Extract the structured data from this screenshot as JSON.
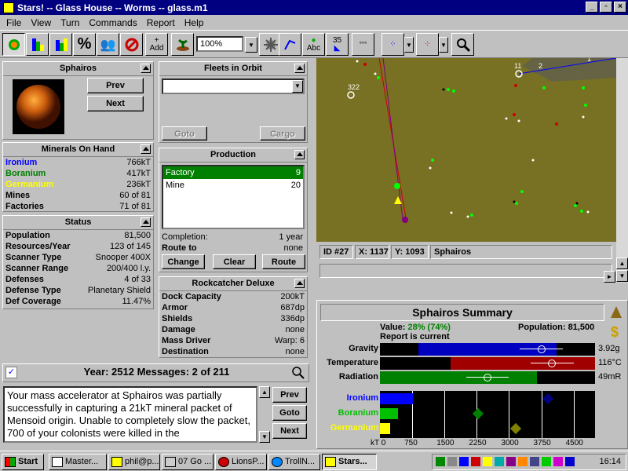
{
  "window": {
    "title": "Stars! -- Glass House -- Worms -- glass.m1"
  },
  "menu": [
    "File",
    "View",
    "Turn",
    "Commands",
    "Report",
    "Help"
  ],
  "toolbar": {
    "zoom": "100%",
    "add_label": "Add",
    "abc_label": "Abc",
    "count_label": "35"
  },
  "planet": {
    "name": "Sphairos",
    "prev": "Prev",
    "next": "Next"
  },
  "minerals": {
    "title": "Minerals On Hand",
    "rows": [
      {
        "label": "Ironium",
        "value": "766kT",
        "color": "#0000ff"
      },
      {
        "label": "Boranium",
        "value": "417kT",
        "color": "#008000"
      },
      {
        "label": "Germanium",
        "value": "236kT",
        "color": "#ffff00"
      },
      {
        "label": "Mines",
        "value": "60 of 81"
      },
      {
        "label": "Factories",
        "value": "71 of 81"
      }
    ]
  },
  "status": {
    "title": "Status",
    "rows": [
      {
        "label": "Population",
        "value": "81,500"
      },
      {
        "label": "Resources/Year",
        "value": "123 of 145"
      },
      {
        "label": "Scanner Type",
        "value": "Snooper 400X"
      },
      {
        "label": "Scanner Range",
        "value": "200/400 l.y."
      },
      {
        "label": "Defenses",
        "value": "4 of 33"
      },
      {
        "label": "Defense Type",
        "value": "Planetary Shield"
      },
      {
        "label": "Def Coverage",
        "value": "11.47%"
      }
    ]
  },
  "fleets": {
    "title": "Fleets in Orbit",
    "goto": "Goto",
    "cargo": "Cargo"
  },
  "production": {
    "title": "Production",
    "items": [
      {
        "name": "Factory",
        "qty": "9"
      },
      {
        "name": "Mine",
        "qty": "20"
      }
    ],
    "completion_label": "Completion:",
    "completion_value": "1 year",
    "route_label": "Route to",
    "route_value": "none",
    "change": "Change",
    "clear": "Clear",
    "route": "Route"
  },
  "starbase": {
    "title": "Rockcatcher Deluxe",
    "rows": [
      {
        "label": "Dock Capacity",
        "value": "200kT"
      },
      {
        "label": "Armor",
        "value": "687dp"
      },
      {
        "label": "Shields",
        "value": "336dp"
      },
      {
        "label": "Damage",
        "value": "none"
      },
      {
        "label": "Mass Driver",
        "value": "Warp: 6"
      },
      {
        "label": "Destination",
        "value": "none"
      }
    ]
  },
  "messages": {
    "header": "Year: 2512   Messages: 2 of 211",
    "text": "Your mass accelerator at Sphairos was partially successfully in capturing a 21kT mineral packet of Mensoid origin. Unable to completely slow the packet, 700 of your colonists were killed in the",
    "prev": "Prev",
    "goto": "Goto",
    "next": "Next"
  },
  "mapinfo": {
    "id": "ID #27",
    "x": "X: 1137",
    "y": "Y: 1093",
    "name": "Sphairos",
    "labels": [
      "322",
      "11",
      "2",
      "1"
    ]
  },
  "summary": {
    "title": "Sphairos Summary",
    "value_label": "Value:",
    "value_num": "28% (74%)",
    "population_label": "Population:",
    "population": "81,500",
    "report": "Report is current",
    "env": [
      {
        "label": "Gravity",
        "value": "3.92g",
        "color": "#0000c0",
        "fill": 0.82,
        "start": 0.18,
        "marker": 0.75
      },
      {
        "label": "Temperature",
        "value": "116°C",
        "color": "#a00000",
        "fill": 1.0,
        "start": 0.33,
        "marker": 0.8
      },
      {
        "label": "Radiation",
        "value": "49mR",
        "color": "#008000",
        "fill": 0.73,
        "start": 0.0,
        "marker": 0.5
      }
    ],
    "mins": [
      {
        "label": "Ironium",
        "color": "#0000ff",
        "fill": 766,
        "marker": 3900,
        "mcolor": "#000080"
      },
      {
        "label": "Boranium",
        "color": "#00c000",
        "fill": 417,
        "marker": 2280,
        "mcolor": "#008000"
      },
      {
        "label": "Germanium",
        "color": "#ffff00",
        "fill": 236,
        "marker": 3150,
        "mcolor": "#808000"
      }
    ],
    "axis": [
      "kT 0",
      "750",
      "1500",
      "2250",
      "3000",
      "3750",
      "4500"
    ]
  },
  "taskbar": {
    "start": "Start",
    "tasks": [
      "Master...",
      "phil@p...",
      "07 Go ...",
      "LionsP...",
      "TrollN...",
      "Stars..."
    ],
    "clock": "16:14"
  }
}
